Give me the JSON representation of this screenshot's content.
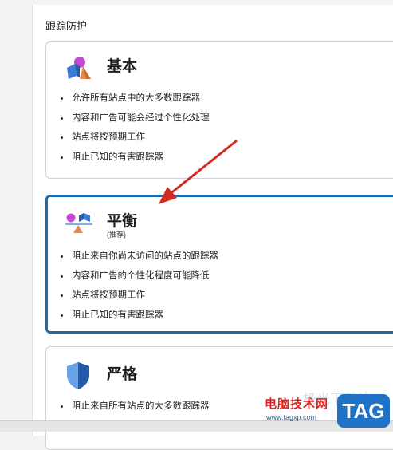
{
  "section": {
    "title": "跟踪防护"
  },
  "cards": [
    {
      "title": "基本",
      "subtitle": "",
      "icon": "shapes-basic-icon",
      "selected": false,
      "bullets": [
        "允许所有站点中的大多数跟踪器",
        "内容和广告可能会经过个性化处理",
        "站点将按预期工作",
        "阻止已知的有害跟踪器"
      ]
    },
    {
      "title": "平衡",
      "subtitle": "(推荐)",
      "icon": "balance-scale-icon",
      "selected": true,
      "bullets": [
        "阻止来自你尚未访问的站点的跟踪器",
        "内容和广告的个性化程度可能降低",
        "站点将按预期工作",
        "阻止已知的有害跟踪器"
      ]
    },
    {
      "title": "严格",
      "subtitle": "",
      "icon": "shield-icon",
      "selected": false,
      "bullets": [
        "阻止来自所有站点的大多数跟踪器"
      ]
    }
  ],
  "watermark": {
    "site_name": "电脑技术网",
    "url": "www.tagxp.com",
    "badge": "TAG",
    "ghost_text": "极光下载站"
  },
  "colors": {
    "selected_border": "#1b6ba8",
    "arrow": "#d42a22",
    "badge_bg": "#1e73c8"
  }
}
